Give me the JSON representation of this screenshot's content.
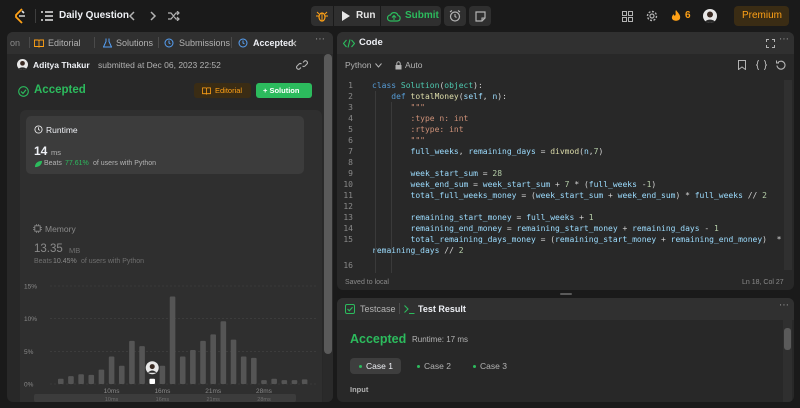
{
  "nav": {
    "title": "Daily Question",
    "run_label": "Run",
    "submit_label": "Submit",
    "streak": "6",
    "premium_label": "Premium"
  },
  "left": {
    "tabs": [
      {
        "label": "on"
      },
      {
        "label": "Editorial"
      },
      {
        "label": "Solutions"
      },
      {
        "label": "Submissions"
      },
      {
        "label": "Accepted"
      }
    ],
    "author": "Aditya Thakur",
    "submitted_text": "submitted at Dec 06, 2023 22:52",
    "status": "Accepted",
    "editorial_btn": "Editorial",
    "solution_btn": "+ Solution",
    "runtime": {
      "title": "Runtime",
      "value": "14",
      "unit": "ms",
      "beats_prefix": "Beats",
      "beats_pct": "77.61%",
      "beats_suffix": "of users with Python"
    },
    "memory": {
      "title": "Memory",
      "value": "13.35",
      "unit": "MB",
      "beats_prefix": "Beats",
      "beats_pct": "10.45%",
      "beats_suffix": "of users with Python"
    }
  },
  "chart_data": {
    "type": "bar",
    "y_ticks": [
      "15%",
      "10%",
      "5%",
      "0%"
    ],
    "ylim": [
      0,
      15
    ],
    "x_ticks": [
      "10ms",
      "16ms",
      "21ms",
      "28ms"
    ],
    "values": [
      0.8,
      1.2,
      1.5,
      1.4,
      2.2,
      4.2,
      2.8,
      6.6,
      5.8,
      0.8,
      2.8,
      13.4,
      4.2,
      5.2,
      6.6,
      7.6,
      9.6,
      6.8,
      4.2,
      4.0,
      0.6,
      0.8,
      0.6,
      0.6,
      0.7
    ],
    "selected_index": 9,
    "grid": true,
    "mini_x_ticks": [
      "10ms",
      "16ms",
      "21ms",
      "28ms"
    ]
  },
  "code": {
    "title": "Code",
    "language": "Python",
    "mode": "Auto",
    "saved": "Saved to local",
    "cursor": "Ln 18, Col 27"
  },
  "testresult": {
    "tab1": "Testcase",
    "tab2": "Test Result",
    "status": "Accepted",
    "runtime": "Runtime: 17 ms",
    "cases": [
      "Case 1",
      "Case 2",
      "Case 3"
    ],
    "input_label": "Input"
  },
  "colors": {
    "accent_green": "#2cbb5d",
    "accent_orange": "#ffa116",
    "bg": "#1a1a1a",
    "panel": "#282828"
  }
}
